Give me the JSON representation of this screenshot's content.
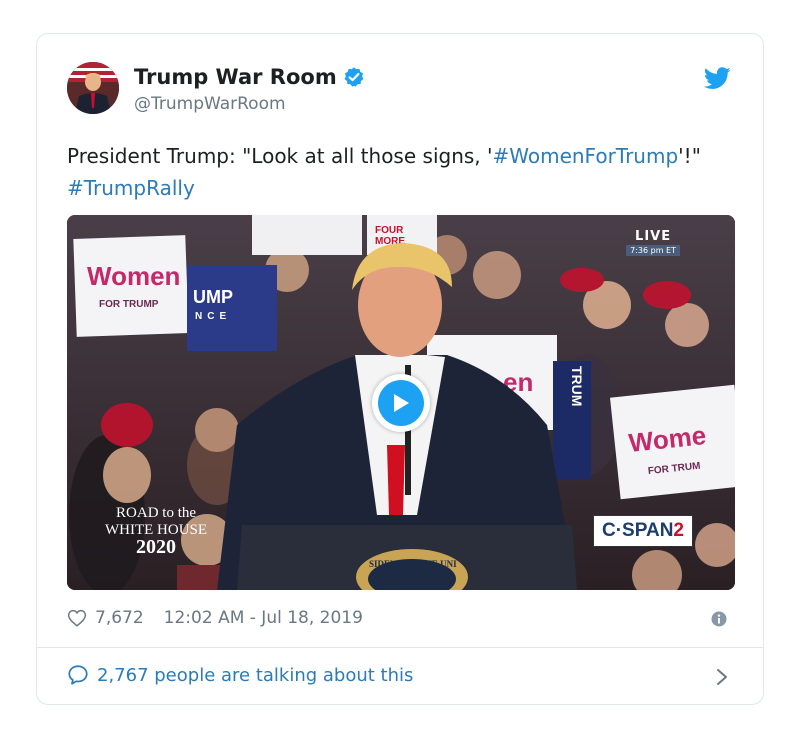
{
  "tweet": {
    "display_name": "Trump War Room",
    "handle": "@TrumpWarRoom",
    "verified_icon": "verified-badge-icon",
    "brand_icon": "twitter-bird-icon",
    "text_prefix": "President Trump: \"Look at all those signs, '",
    "hashtag_1": "#WomenForTrump",
    "text_middle": "'!\" ",
    "hashtag_2": "#TrumpRally",
    "likes": "7,672",
    "timestamp": "12:02 AM - Jul 18, 2019",
    "talking": "2,767 people are talking about this"
  },
  "video": {
    "live_label": "LIVE",
    "live_time": "7:36 pm ET",
    "network_prefix": "C·SPAN",
    "network_number": "2",
    "road_line_1": "ROAD to the",
    "road_line_2": "WHITE HOUSE",
    "road_year": "2020",
    "sign_women": "Women",
    "sign_for_trump": "FOR TRUMP",
    "sign_ump": "UMP",
    "sign_nce": "NCE",
    "sign_four": "FOUR",
    "sign_more": "MORE",
    "sign_en": "en",
    "sign_trum": "TRUM",
    "sign_women_right": "Wome",
    "sign_for_trum": "FOR TRUM",
    "seal_text": "SIDENT OF THE UNI"
  },
  "colors": {
    "link": "#2b7bb9",
    "twitter_blue": "#1da1f2",
    "muted": "#697882",
    "text": "#1c2022",
    "border": "#e1e8ed"
  }
}
